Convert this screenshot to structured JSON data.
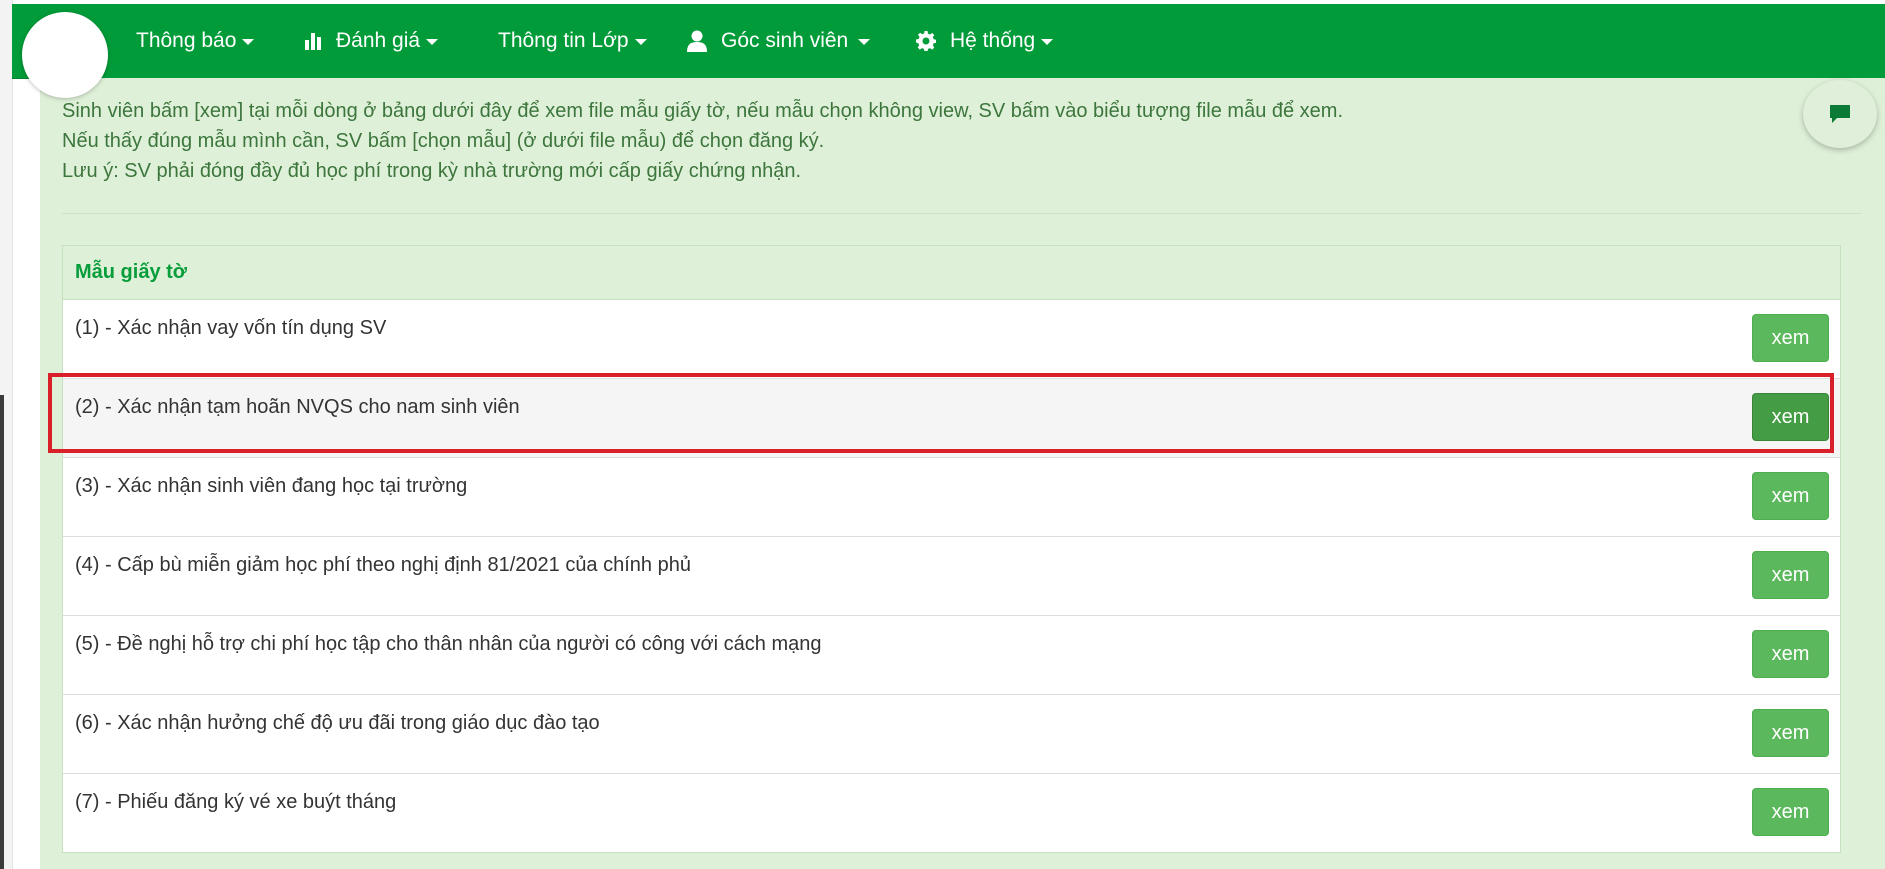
{
  "navbar": {
    "items": [
      {
        "label": "Thông báo",
        "icon": "none"
      },
      {
        "label": "Đánh giá",
        "icon": "bar-chart-icon"
      },
      {
        "label": "Thông tin Lớp",
        "icon": "none"
      },
      {
        "label": "Góc sinh viên",
        "icon": "user-icon"
      },
      {
        "label": "Hệ thống",
        "icon": "gear-icon"
      }
    ],
    "color": "#019c39"
  },
  "notes": {
    "line1": "Sinh viên bấm [xem] tại mỗi dòng ở bảng dưới đây để xem file mẫu giấy tờ, nếu mẫu chọn không view, SV bấm vào biểu tượng file mẫu để xem.",
    "line2": "Nếu thấy đúng mẫu mình cần, SV bấm [chọn mẫu] (ở dưới file mẫu) để chọn đăng ký.",
    "line3": "Lưu ý: SV phải đóng đầy đủ học phí trong kỳ nhà trường mới cấp giấy chứng nhận."
  },
  "panel": {
    "title": "Mẫu giấy tờ",
    "rows": [
      {
        "label": "(1) - Xác nhận vay vốn tín dụng SV",
        "button": "xem"
      },
      {
        "label": "(2) - Xác nhận tạm hoãn NVQS cho nam sinh viên",
        "button": "xem"
      },
      {
        "label": "(3) - Xác nhận sinh viên đang học tại trường",
        "button": "xem"
      },
      {
        "label": "(4) - Cấp bù miễn giảm học phí theo nghị định 81/2021 của chính phủ",
        "button": "xem"
      },
      {
        "label": "(5) - Đề nghị hỗ trợ chi phí học tập cho thân nhân của người có công với cách mạng",
        "button": "xem"
      },
      {
        "label": "(6) - Xác nhận hưởng chế độ ưu đãi trong giáo dục đào tạo",
        "button": "xem"
      },
      {
        "label": "(7) - Phiếu đăng ký vé xe buýt tháng",
        "button": "xem"
      }
    ]
  },
  "colors": {
    "accent_green": "#5cb85c",
    "panel_bg": "#dff0d8",
    "highlight": "#d9202a"
  }
}
